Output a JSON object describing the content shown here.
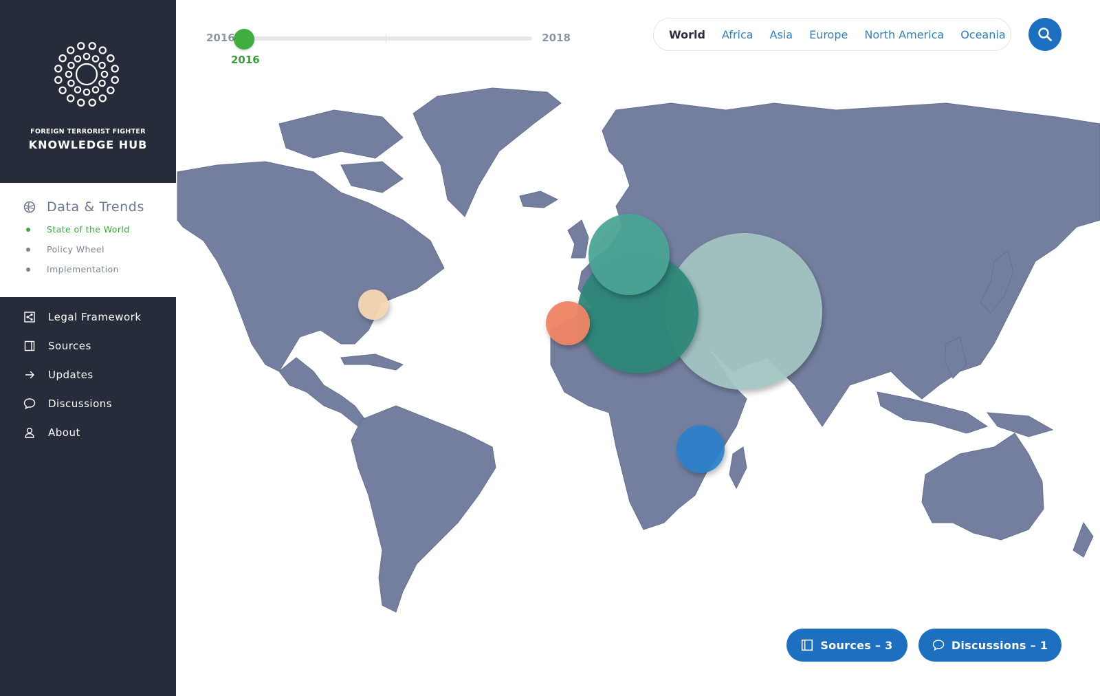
{
  "brand": {
    "subtitle": "FOREIGN TERRORIST FIGHTER",
    "title": "KNOWLEDGE HUB"
  },
  "data_section": {
    "title": "Data & Trends",
    "icon": "globe-icon",
    "items": [
      {
        "label": "State of the World",
        "active": true
      },
      {
        "label": "Policy Wheel",
        "active": false
      },
      {
        "label": "Implementation",
        "active": false
      }
    ]
  },
  "nav": {
    "items": [
      {
        "label": "Legal Framework",
        "icon": "share-icon"
      },
      {
        "label": "Sources",
        "icon": "book-icon"
      },
      {
        "label": "Updates",
        "icon": "arrow-right-icon"
      },
      {
        "label": "Discussions",
        "icon": "chat-icon"
      },
      {
        "label": "About",
        "icon": "user-icon"
      }
    ]
  },
  "timeline": {
    "start": "2016",
    "end": "2018",
    "current": "2016",
    "position": 0
  },
  "regions": {
    "tabs": [
      "World",
      "Africa",
      "Asia",
      "Europe",
      "North America",
      "Oceania"
    ],
    "active": "World"
  },
  "search": {
    "icon": "search-icon"
  },
  "actions": {
    "sources": "Sources – 3",
    "discussions": "Discussions – 1"
  },
  "colors": {
    "sidebar_dark": "#262c39",
    "accent_green": "#3fae3f",
    "accent_blue": "#1d6fbf",
    "land": "#747f9f"
  }
}
